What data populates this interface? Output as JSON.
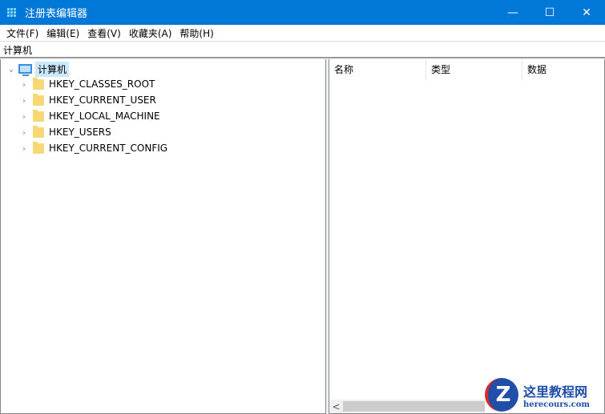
{
  "window": {
    "title": "注册表编辑器",
    "minimize": "—",
    "maximize": "☐",
    "close": "✕"
  },
  "menu": [
    "文件(F)",
    "编辑(E)",
    "查看(V)",
    "收藏夹(A)",
    "帮助(H)"
  ],
  "address": "计算机",
  "tree": {
    "root": "计算机",
    "children": [
      "HKEY_CLASSES_ROOT",
      "HKEY_CURRENT_USER",
      "HKEY_LOCAL_MACHINE",
      "HKEY_USERS",
      "HKEY_CURRENT_CONFIG"
    ]
  },
  "list": {
    "columns": [
      "名称",
      "类型",
      "数据"
    ],
    "scroll_left": "<"
  },
  "watermark": {
    "logo": "Z",
    "name": "这里教程网",
    "site": "herecours.com"
  }
}
